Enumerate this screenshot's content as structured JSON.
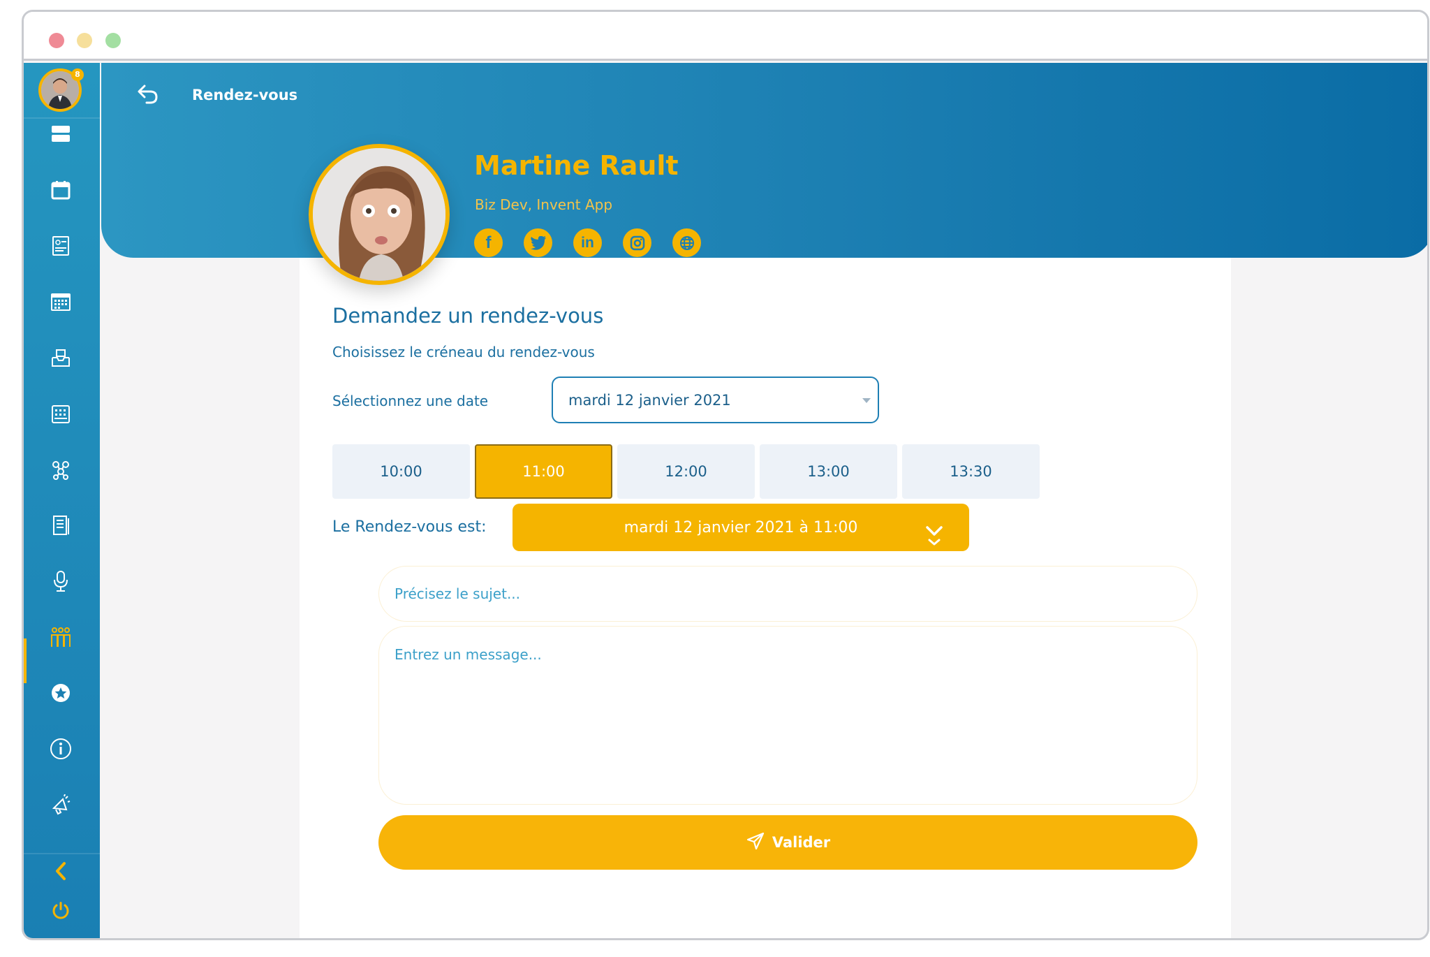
{
  "header": {
    "title": "Rendez-vous"
  },
  "sidebar": {
    "badge_count": "8",
    "items": [
      {
        "icon": "list-icon"
      },
      {
        "icon": "calendar-icon"
      },
      {
        "icon": "contact-card-icon"
      },
      {
        "icon": "schedule-grid-icon"
      },
      {
        "icon": "inbox-icon"
      },
      {
        "icon": "agenda-icon"
      },
      {
        "icon": "network-icon"
      },
      {
        "icon": "document-icon"
      },
      {
        "icon": "microphone-icon"
      },
      {
        "icon": "people-icon",
        "active": true
      },
      {
        "icon": "star-icon"
      },
      {
        "icon": "info-icon"
      },
      {
        "icon": "megaphone-icon"
      }
    ],
    "collapse_icon": "chevron-left-icon",
    "logout_icon": "power-icon"
  },
  "profile": {
    "name": "Martine Rault",
    "role": "Biz Dev, Invent App",
    "socials": [
      {
        "name": "facebook-icon",
        "glyph": "f"
      },
      {
        "name": "twitter-icon",
        "glyph": ""
      },
      {
        "name": "linkedin-icon",
        "glyph": "in"
      },
      {
        "name": "instagram-icon",
        "glyph": ""
      },
      {
        "name": "website-icon",
        "glyph": ""
      }
    ]
  },
  "form": {
    "title": "Demandez un rendez-vous",
    "subtitle": "Choisissez le créneau du rendez-vous",
    "date_label": "Sélectionnez une date",
    "date_value": "mardi 12 janvier 2021",
    "slots": [
      "10:00",
      "11:00",
      "12:00",
      "13:00",
      "13:30"
    ],
    "selected_slot": "11:00",
    "summary_label": "Le Rendez-vous est:",
    "summary_value": "mardi 12 janvier 2021 à 11:00",
    "subject_placeholder": "Précisez le sujet...",
    "message_placeholder": "Entrez un message...",
    "submit_label": "Valider"
  },
  "colors": {
    "primary": "#1c7fb2",
    "accent": "#f5b400",
    "background": "#f5f4f5"
  }
}
